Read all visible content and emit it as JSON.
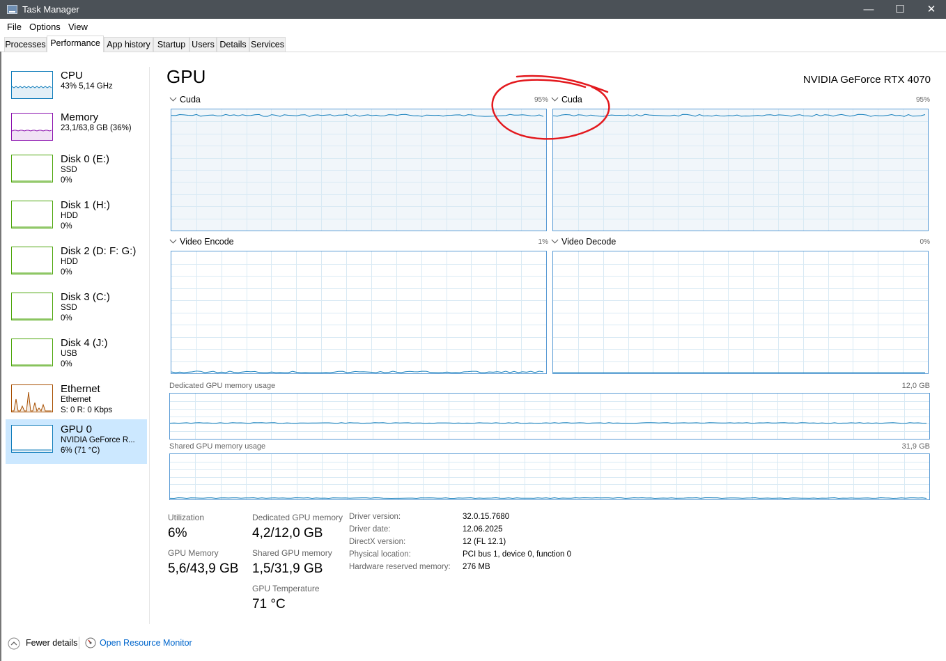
{
  "window": {
    "title": "Task Manager",
    "minimize_glyph": "—",
    "maximize_glyph": "☐",
    "close_glyph": "✕"
  },
  "menu": [
    "File",
    "Options",
    "View"
  ],
  "tabs": [
    {
      "label": "Processes"
    },
    {
      "label": "Performance",
      "active": true
    },
    {
      "label": "App history"
    },
    {
      "label": "Startup"
    },
    {
      "label": "Users"
    },
    {
      "label": "Details"
    },
    {
      "label": "Services"
    }
  ],
  "sidebar": {
    "items": [
      {
        "name": "CPU",
        "lines": [
          "43%  5,14 GHz"
        ],
        "color": "#117dbb"
      },
      {
        "name": "Memory",
        "lines": [
          "23,1/63,8 GB (36%)"
        ],
        "color": "#8b12ae"
      },
      {
        "name": "Disk 0 (E:)",
        "lines": [
          "SSD",
          "0%"
        ],
        "color": "#4da60c"
      },
      {
        "name": "Disk 1 (H:)",
        "lines": [
          "HDD",
          "0%"
        ],
        "color": "#4da60c"
      },
      {
        "name": "Disk 2 (D: F: G:)",
        "lines": [
          "HDD",
          "0%"
        ],
        "color": "#4da60c"
      },
      {
        "name": "Disk 3 (C:)",
        "lines": [
          "SSD",
          "0%"
        ],
        "color": "#4da60c"
      },
      {
        "name": "Disk 4 (J:)",
        "lines": [
          "USB",
          "0%"
        ],
        "color": "#4da60c"
      },
      {
        "name": "Ethernet",
        "lines": [
          "Ethernet",
          "S: 0  R: 0 Kbps"
        ],
        "color": "#a74f01"
      },
      {
        "name": "GPU 0",
        "lines": [
          "NVIDIA GeForce R...",
          "6%  (71 °C)"
        ],
        "color": "#117dbb",
        "selected": true
      }
    ]
  },
  "gpu": {
    "title": "GPU",
    "model": "NVIDIA GeForce RTX 4070",
    "engines": [
      {
        "label": "Cuda",
        "percent": "95%",
        "level": 0.95
      },
      {
        "label": "Cuda",
        "percent": "95%",
        "level": 0.95
      },
      {
        "label": "Video Encode",
        "percent": "1%",
        "level": 0.01
      },
      {
        "label": "Video Decode",
        "percent": "0%",
        "level": 0.0
      }
    ],
    "dedicated_memory": {
      "label": "Dedicated GPU memory usage",
      "max": "12,0 GB",
      "level": 0.35
    },
    "shared_memory": {
      "label": "Shared GPU memory usage",
      "max": "31,9 GB",
      "level": 0.03
    }
  },
  "stats": {
    "utilization": {
      "label": "Utilization",
      "value": "6%"
    },
    "dedicated": {
      "label": "Dedicated GPU memory",
      "value": "4,2/12,0 GB"
    },
    "gpu_memory": {
      "label": "GPU Memory",
      "value": "5,6/43,9 GB"
    },
    "shared": {
      "label": "Shared GPU memory",
      "value": "1,5/31,9 GB"
    },
    "temperature": {
      "label": "GPU Temperature",
      "value": "71 °C"
    }
  },
  "info": [
    {
      "label": "Driver version:",
      "value": "32.0.15.7680"
    },
    {
      "label": "Driver date:",
      "value": "12.06.2025"
    },
    {
      "label": "DirectX version:",
      "value": "12 (FL 12.1)"
    },
    {
      "label": "Physical location:",
      "value": "PCI bus 1, device 0, function 0"
    },
    {
      "label": "Hardware reserved memory:",
      "value": "276 MB"
    }
  ],
  "footer": {
    "fewer_details": "Fewer details",
    "open_resource_monitor": "Open Resource Monitor"
  },
  "colors": {
    "graph_line": "#117dbb",
    "graph_fill": "#f1f6fa",
    "grid": "#d9eaf4",
    "annotation": "#e3191e",
    "selected": "#cce8ff",
    "link": "#0066cc"
  }
}
